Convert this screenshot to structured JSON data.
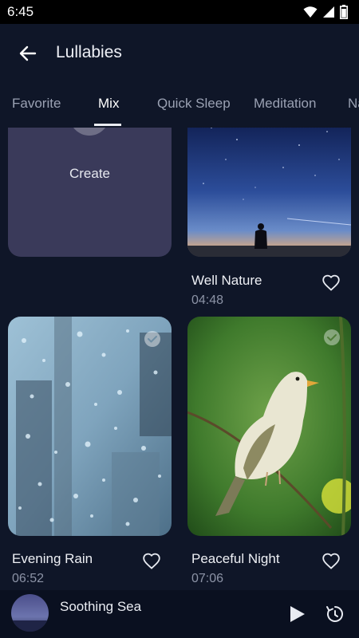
{
  "status": {
    "time": "6:45"
  },
  "header": {
    "title": "Lullabies"
  },
  "tabs": [
    {
      "label": "Favorite",
      "active": false
    },
    {
      "label": "Mix",
      "active": true
    },
    {
      "label": "Quick Sleep",
      "active": false
    },
    {
      "label": "Meditation",
      "active": false
    },
    {
      "label": "Na",
      "active": false
    }
  ],
  "create": {
    "label": "Create"
  },
  "items": [
    {
      "title": "Well Nature",
      "duration": "04:48",
      "image": "night-sky-silhouette",
      "selected": false
    },
    {
      "title": "Evening Rain",
      "duration": "06:52",
      "image": "raindrops-on-window",
      "selected": true
    },
    {
      "title": "Peaceful Night",
      "duration": "07:06",
      "image": "bird-on-branch",
      "selected": true
    }
  ],
  "player": {
    "title": "Soothing Sea",
    "icons": [
      "play-icon",
      "timer-icon"
    ]
  },
  "colors": {
    "background": "#0f1628",
    "card": "#3a3a5a",
    "accent": "#ffffff"
  }
}
